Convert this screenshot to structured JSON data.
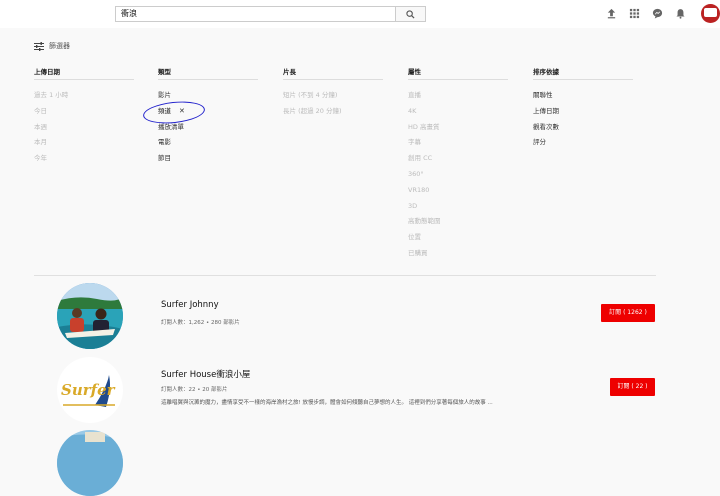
{
  "search": {
    "query": "衝浪"
  },
  "filters": {
    "label": "篩選器",
    "columns": [
      {
        "title": "上傳日期",
        "options": [
          "過去 1 小時",
          "今日",
          "本週",
          "本月",
          "今年"
        ],
        "states": [
          "dim",
          "dim",
          "dim",
          "dim",
          "dim"
        ]
      },
      {
        "title": "類型",
        "options": [
          "影片",
          "頻道",
          "播放清單",
          "電影",
          "節目"
        ],
        "states": [
          "active",
          "selected",
          "active",
          "active",
          "active"
        ]
      },
      {
        "title": "片長",
        "options": [
          "短片 (不到 4 分鐘)",
          "長片 (超過 20 分鐘)"
        ],
        "states": [
          "dim",
          "dim"
        ]
      },
      {
        "title": "屬性",
        "options": [
          "直播",
          "4K",
          "HD 高畫質",
          "字幕",
          "創用 CC",
          "360°",
          "VR180",
          "3D",
          "高動態範圍",
          "位置",
          "已購買"
        ],
        "states": [
          "dim",
          "dim",
          "dim",
          "dim",
          "dim",
          "dim",
          "dim",
          "dim",
          "dim",
          "dim",
          "dim"
        ]
      },
      {
        "title": "排序依據",
        "options": [
          "關聯性",
          "上傳日期",
          "觀看次數",
          "評分"
        ],
        "states": [
          "active",
          "active",
          "active",
          "active"
        ]
      }
    ]
  },
  "results": [
    {
      "name": "Surfer Johnny",
      "meta": "訂閱人數：1,262 • 280 部影片",
      "description": "",
      "subscribe_label": "訂閱 ( 1262 )"
    },
    {
      "name": "Surfer House衝浪小屋",
      "meta": "訂閱人數：22 • 20 部影片",
      "description": "這離唱翼與沉澱的魔力，盡情享受不一樣的海岸漁村之旅! 放慢步調，體會如何傾聽自己夢想的人生。 這裡到們分享著每個旅人的故事 ...",
      "subscribe_label": "訂閱 ( 22 )"
    }
  ],
  "logo_text": {
    "surfer": "Surfer"
  },
  "colors": {
    "subscribe": "#ee0000",
    "annotation": "#2222cc"
  }
}
